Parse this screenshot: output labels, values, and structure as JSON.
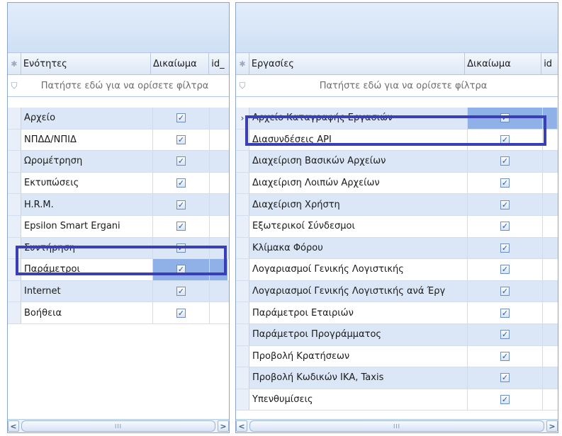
{
  "left": {
    "headers": {
      "name": "Ενότητες",
      "perm": "Δικαίωμα",
      "id": "id_"
    },
    "filter_text": "Πατήστε εδώ για να ορίσετε φίλτρα",
    "rows": [
      {
        "name": "Αρχείο",
        "checked": true
      },
      {
        "name": "ΝΠΔΔ/ΝΠΙΔ",
        "checked": true
      },
      {
        "name": "Ωρομέτρηση",
        "checked": true
      },
      {
        "name": "Εκτυπώσεις",
        "checked": true
      },
      {
        "name": "H.R.M.",
        "checked": true
      },
      {
        "name": "Epsilon Smart Ergani",
        "checked": true
      },
      {
        "name": "Συντήρηση",
        "checked": true
      },
      {
        "name": "Παράμετροι",
        "checked": true
      },
      {
        "name": "Internet",
        "checked": true
      },
      {
        "name": "Βοήθεια",
        "checked": true
      }
    ],
    "selected_row": "Παράμετροι"
  },
  "right": {
    "headers": {
      "name": "Εργασίες",
      "perm": "Δικαίωμα",
      "id": "id"
    },
    "filter_text": "Πατήστε εδώ για να ορίσετε φίλτρα",
    "rows": [
      {
        "name": "Αρχείο Καταγραφής Εργασιών",
        "checked": true
      },
      {
        "name": "Διασυνδέσεις API",
        "checked": true
      },
      {
        "name": "Διαχείριση Βασικών Αρχείων",
        "checked": true
      },
      {
        "name": "Διαχείριση Λοιπών Αρχείων",
        "checked": true
      },
      {
        "name": "Διαχείριση Χρήστη",
        "checked": true
      },
      {
        "name": "Εξωτερικοί Σύνδεσμοι",
        "checked": true
      },
      {
        "name": "Κλίμακα Φόρου",
        "checked": true
      },
      {
        "name": "Λογαριασμοί Γενικής Λογιστικής",
        "checked": true
      },
      {
        "name": "Λογαριασμοί Γενικής Λογιστικής ανά Έργ",
        "checked": true
      },
      {
        "name": "Παράμετροι Εταιριών",
        "checked": true
      },
      {
        "name": "Παράμετροι Προγράμματος",
        "checked": true
      },
      {
        "name": "Προβολή Κρατήσεων",
        "checked": true
      },
      {
        "name": "Προβολή Κωδικών ΙΚΑ, Taxis",
        "checked": true
      },
      {
        "name": "Υπενθυμίσεις",
        "checked": true
      }
    ],
    "current_row": "Αρχείο Καταγραφής Εργασιών",
    "highlighted_row": "Διασυνδέσεις API"
  },
  "scrollbar": {
    "left_arrow": "<",
    "right_arrow": ">",
    "grip": "III"
  },
  "colors": {
    "highlight_border": "#3a3fb8",
    "alt_row": "#dbe6f7",
    "selected_cell": "#8fb1e8"
  }
}
